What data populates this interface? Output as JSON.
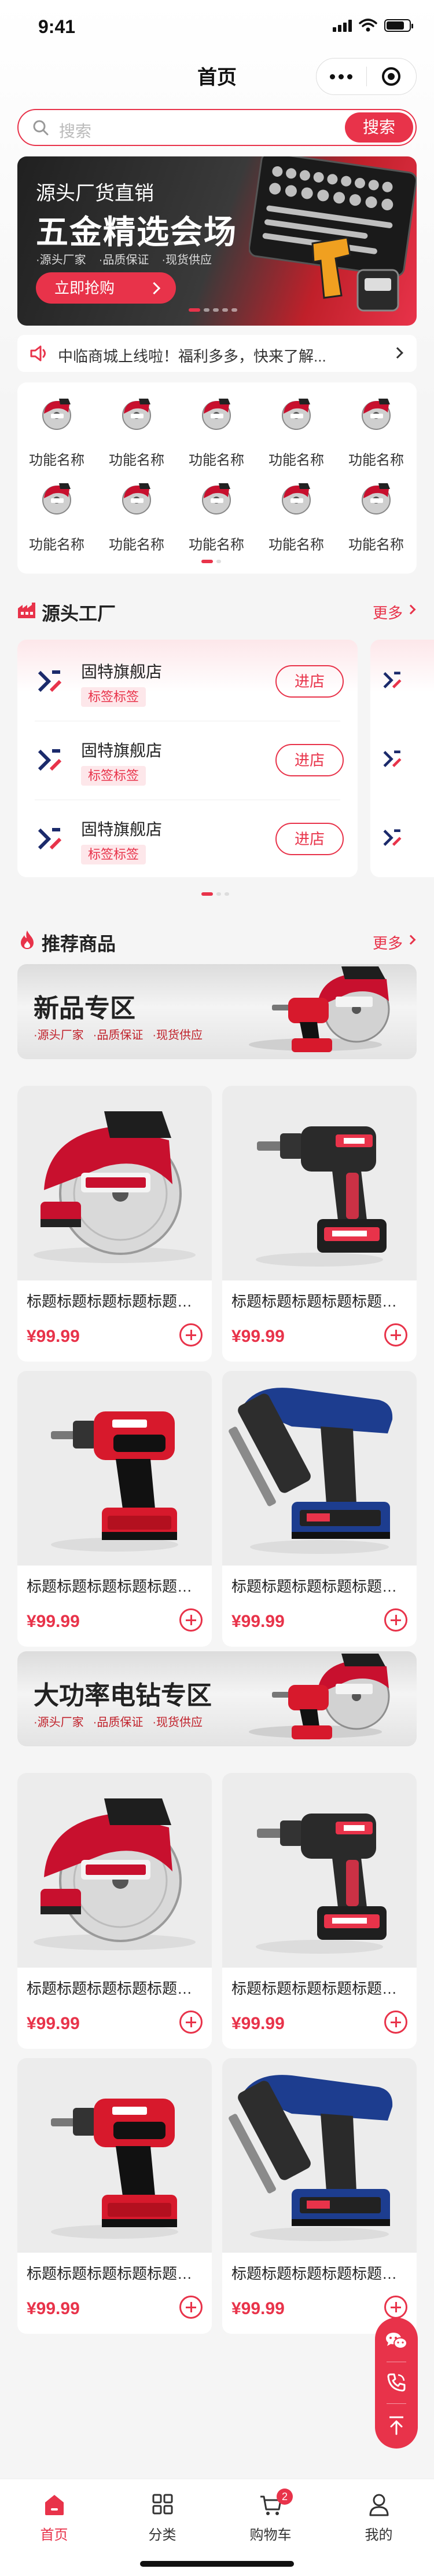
{
  "status_bar": {
    "time": "9:41"
  },
  "nav": {
    "title": "首页"
  },
  "search": {
    "placeholder": "搜索",
    "button_label": "搜索"
  },
  "banner": {
    "subtitle": "源头厂货直销",
    "title": "五金精选会场",
    "tags": [
      "·源头厂家",
      "·品质保证",
      "·现货供应"
    ],
    "cta_label": "立即抢购"
  },
  "notice": {
    "text": "中临商城上线啦！福利多多，快来了解..."
  },
  "functions": {
    "items": [
      {
        "label": "功能名称"
      },
      {
        "label": "功能名称"
      },
      {
        "label": "功能名称"
      },
      {
        "label": "功能名称"
      },
      {
        "label": "功能名称"
      },
      {
        "label": "功能名称"
      },
      {
        "label": "功能名称"
      },
      {
        "label": "功能名称"
      },
      {
        "label": "功能名称"
      },
      {
        "label": "功能名称"
      }
    ]
  },
  "factory": {
    "title": "源头工厂",
    "more_label": "更多",
    "stores": [
      {
        "name": "固特旗舰店",
        "tag": "标签标签",
        "enter_label": "进店"
      },
      {
        "name": "固特旗舰店",
        "tag": "标签标签",
        "enter_label": "进店"
      },
      {
        "name": "固特旗舰店",
        "tag": "标签标签",
        "enter_label": "进店"
      }
    ]
  },
  "recommend": {
    "title": "推荐商品",
    "more_label": "更多"
  },
  "zones": [
    {
      "title": "新品专区",
      "tags": [
        "·源头厂家",
        "·品质保证",
        "·现货供应"
      ],
      "products": [
        {
          "title": "标题标题标题标题标题标题标题",
          "price": "¥99.99",
          "image": "circular-saw"
        },
        {
          "title": "标题标题标题标题标题标题标题",
          "price": "¥99.99",
          "image": "drill-black"
        },
        {
          "title": "标题标题标题标题标题标题标题",
          "price": "¥99.99",
          "image": "drill-red"
        },
        {
          "title": "标题标题标题标题标题标题标题",
          "price": "¥99.99",
          "image": "nail-gun"
        }
      ]
    },
    {
      "title": "大功率电钻专区",
      "tags": [
        "·源头厂家",
        "·品质保证",
        "·现货供应"
      ],
      "products": [
        {
          "title": "标题标题标题标题标题标题标题",
          "price": "¥99.99",
          "image": "circular-saw"
        },
        {
          "title": "标题标题标题标题标题标题标题",
          "price": "¥99.99",
          "image": "drill-black"
        },
        {
          "title": "标题标题标题标题标题标题标题",
          "price": "¥99.99",
          "image": "drill-red"
        },
        {
          "title": "标题标题标题标题标题标题标题",
          "price": "¥99.99",
          "image": "nail-gun"
        }
      ]
    }
  ],
  "tabbar": {
    "items": [
      {
        "label": "首页",
        "icon": "home-icon",
        "active": true
      },
      {
        "label": "分类",
        "icon": "grid-icon",
        "active": false
      },
      {
        "label": "购物车",
        "icon": "cart-icon",
        "active": false,
        "badge": "2"
      },
      {
        "label": "我的",
        "icon": "user-icon",
        "active": false
      }
    ]
  },
  "colors": {
    "accent": "#e8334a",
    "background": "#f5f5f5"
  }
}
